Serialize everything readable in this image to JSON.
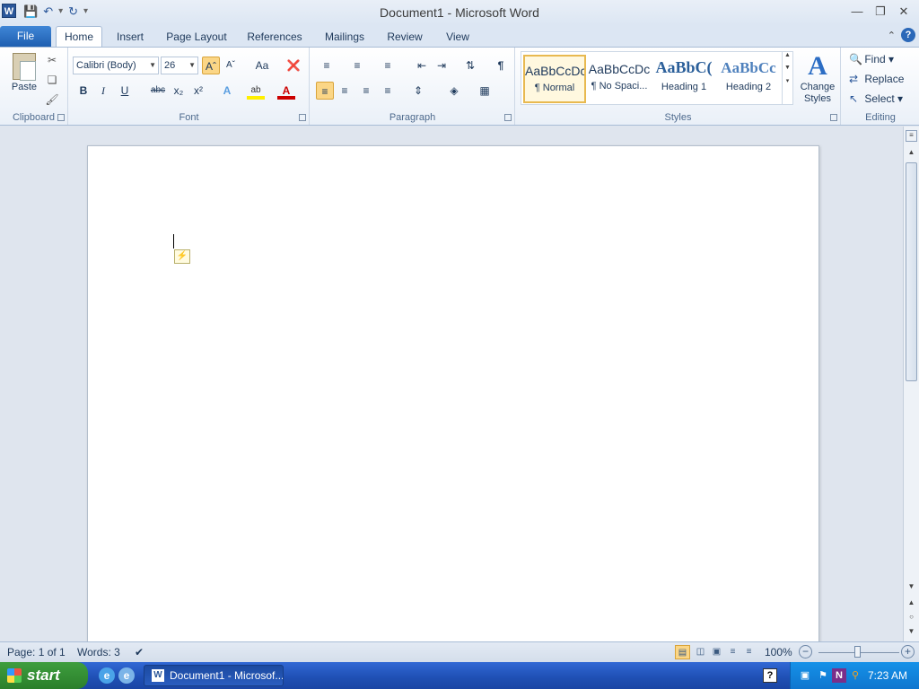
{
  "window": {
    "title": "Document1 - Microsoft Word",
    "app_icon_letter": "W",
    "controls": [
      "minimize",
      "restore",
      "close"
    ]
  },
  "quick_access": {
    "icons": [
      "save-icon",
      "undo-icon",
      "redo-icon",
      "customize-icon"
    ]
  },
  "tabs": {
    "file": "File",
    "items": [
      "Home",
      "Insert",
      "Page Layout",
      "References",
      "Mailings",
      "Review",
      "View"
    ],
    "active": "Home"
  },
  "ribbon": {
    "clipboard": {
      "label": "Clipboard",
      "paste": "Paste"
    },
    "font": {
      "label": "Font",
      "font_name": "Calibri (Body)",
      "font_size": "26",
      "grow_font_active": true,
      "buttons": {
        "bold": "B",
        "italic": "I",
        "underline": "U",
        "strike": "abc",
        "subscript": "x₂",
        "superscript": "x²",
        "change_case": "Aa"
      }
    },
    "paragraph": {
      "label": "Paragraph",
      "align_left_active": true
    },
    "styles": {
      "label": "Styles",
      "items": [
        {
          "sample": "AaBbCcDc",
          "name": "¶ Normal",
          "selected": true
        },
        {
          "sample": "AaBbCcDc",
          "name": "¶ No Spaci...",
          "selected": false
        },
        {
          "sample": "AaBbC(",
          "name": "Heading 1",
          "selected": false
        },
        {
          "sample": "AaBbCc",
          "name": "Heading 2",
          "selected": false
        }
      ],
      "change_styles_line1": "Change",
      "change_styles_line2": "Styles"
    },
    "editing": {
      "label": "Editing",
      "find": "Find",
      "replace": "Replace",
      "select": "Select"
    }
  },
  "document": {
    "body_text": ""
  },
  "status": {
    "page": "Page: 1 of 1",
    "words": "Words: 3",
    "zoom": "100%",
    "zoom_level_percent": 100,
    "active_view": "print-layout"
  },
  "taskbar": {
    "start": "start",
    "task_button": "Document1 - Microsof...",
    "clock": "7:23 AM"
  }
}
